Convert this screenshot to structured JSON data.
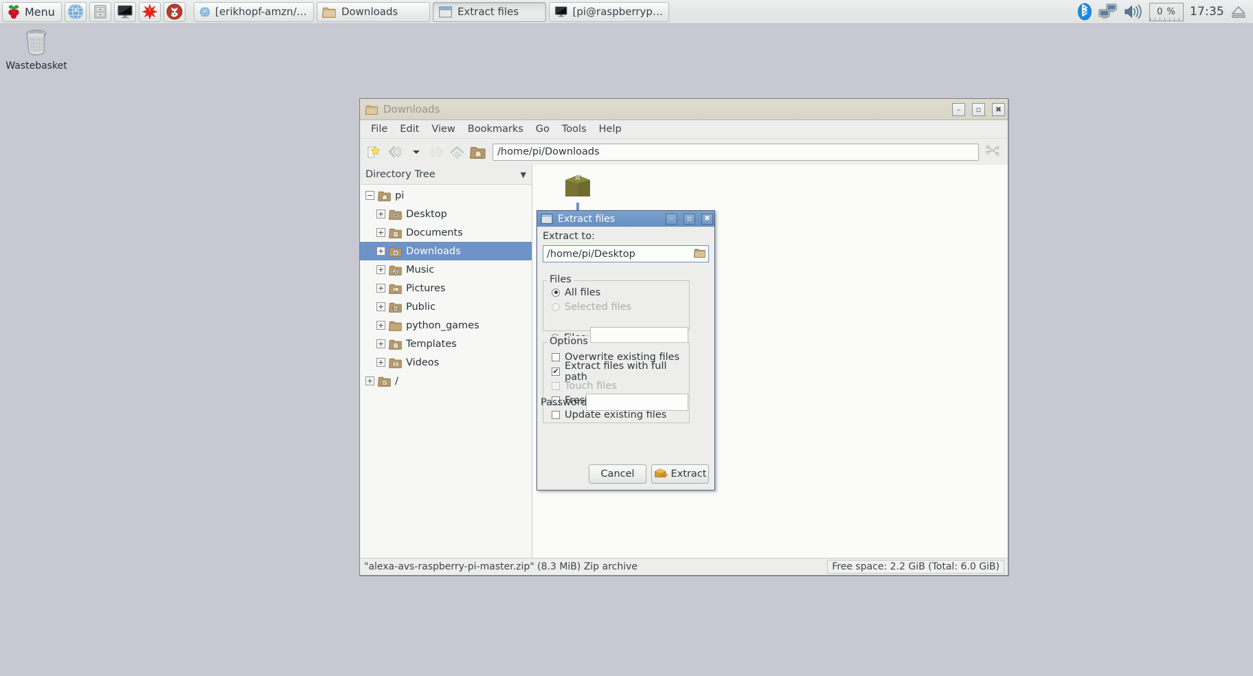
{
  "taskbar": {
    "menu_label": "Menu",
    "launchers": [
      {
        "name": "web-browser-launcher",
        "icon": "globe-icon"
      },
      {
        "name": "file-manager-launcher",
        "icon": "file-cabinet-icon"
      },
      {
        "name": "terminal-launcher",
        "icon": "monitor-icon"
      },
      {
        "name": "mathematica-launcher",
        "icon": "red-star-icon"
      },
      {
        "name": "wolfram-launcher",
        "icon": "wolf-icon"
      }
    ],
    "windows": [
      {
        "label": "[erikhopf-amzn/alexa…",
        "icon": "globe-icon",
        "active": false
      },
      {
        "label": "Downloads",
        "icon": "folder-icon",
        "active": false
      },
      {
        "label": "Extract files",
        "icon": "window-icon",
        "active": true
      },
      {
        "label": "[pi@raspberrypi: ~]",
        "icon": "monitor-icon",
        "active": false
      }
    ],
    "tray": {
      "bluetooth": "bluetooth-icon",
      "network": "network-icon",
      "volume": "volume-icon",
      "cpu_percent": "0 %",
      "clock": "17:35",
      "eject": "eject-icon"
    }
  },
  "desktop": {
    "icons": [
      {
        "label": "Wastebasket",
        "icon": "wastebasket-icon"
      }
    ]
  },
  "file_manager": {
    "title": "Downloads",
    "window_buttons": {
      "minimize": "–",
      "maximize": "▫",
      "close": "✖"
    },
    "menus": [
      "File",
      "Edit",
      "View",
      "Bookmarks",
      "Go",
      "Tools",
      "Help"
    ],
    "toolbar_icons": [
      "new-tab-icon",
      "back-icon",
      "history-dropdown-icon",
      "forward-icon",
      "up-icon",
      "home-icon"
    ],
    "path": "/home/pi/Downloads",
    "sidebar": {
      "header": "Directory Tree",
      "tree": [
        {
          "label": "pi",
          "icon": "home-folder-icon",
          "indent": 0,
          "expander": "−",
          "selected": false
        },
        {
          "label": "Desktop",
          "icon": "desktop-folder-icon",
          "indent": 1,
          "expander": "+",
          "selected": false
        },
        {
          "label": "Documents",
          "icon": "documents-folder-icon",
          "indent": 1,
          "expander": "+",
          "selected": false
        },
        {
          "label": "Downloads",
          "icon": "downloads-folder-icon",
          "indent": 1,
          "expander": "+",
          "selected": true
        },
        {
          "label": "Music",
          "icon": "music-folder-icon",
          "indent": 1,
          "expander": "+",
          "selected": false
        },
        {
          "label": "Pictures",
          "icon": "pictures-folder-icon",
          "indent": 1,
          "expander": "+",
          "selected": false
        },
        {
          "label": "Public",
          "icon": "public-folder-icon",
          "indent": 1,
          "expander": "+",
          "selected": false
        },
        {
          "label": "python_games",
          "icon": "folder-icon",
          "indent": 1,
          "expander": "+",
          "selected": false
        },
        {
          "label": "Templates",
          "icon": "templates-folder-icon",
          "indent": 1,
          "expander": "+",
          "selected": false
        },
        {
          "label": "Videos",
          "icon": "videos-folder-icon",
          "indent": 1,
          "expander": "+",
          "selected": false
        },
        {
          "label": "/",
          "icon": "root-folder-icon",
          "indent": 0,
          "expander": "+",
          "selected": false
        }
      ]
    },
    "files": [
      {
        "label": "",
        "icon": "zip-archive-icon",
        "selected": true
      }
    ],
    "status_left": "\"alexa-avs-raspberry-pi-master.zip\" (8.3 MiB) Zip archive",
    "status_right": "Free space: 2.2 GiB (Total: 6.0 GiB)"
  },
  "extract_dialog": {
    "title": "Extract files",
    "window_buttons": {
      "minimize": "–",
      "maximize": "▫",
      "close": "✖"
    },
    "extract_to_label": "Extract to:",
    "extract_to_value": "/home/pi/Desktop",
    "browse_icon": "folder-browse-icon",
    "files_group": {
      "caption": "Files",
      "radios": [
        {
          "label": "All files",
          "selected": true,
          "disabled": false
        },
        {
          "label": "Selected files",
          "selected": false,
          "disabled": true
        },
        {
          "label": "Files:",
          "selected": false,
          "disabled": false
        }
      ],
      "files_value": ""
    },
    "options_group": {
      "caption": "Options",
      "checkboxes": [
        {
          "label": "Overwrite existing files",
          "checked": false,
          "disabled": false
        },
        {
          "label": "Extract files with full path",
          "checked": true,
          "disabled": false
        },
        {
          "label": "Touch files",
          "checked": false,
          "disabled": true
        },
        {
          "label": "Freshen existing files",
          "checked": false,
          "disabled": false
        },
        {
          "label": "Update existing files",
          "checked": false,
          "disabled": false
        }
      ]
    },
    "password_label": "Password:",
    "password_value": "",
    "cancel_label": "Cancel",
    "extract_label": "Extract",
    "extract_icon": "extract-archive-icon"
  },
  "colors": {
    "selection_blue": "#6d93c8",
    "dialog_titlebar": "#6f97c6",
    "desktop_bg": "#c8c8d2",
    "taskbar_bg": "#e4e8e6"
  }
}
